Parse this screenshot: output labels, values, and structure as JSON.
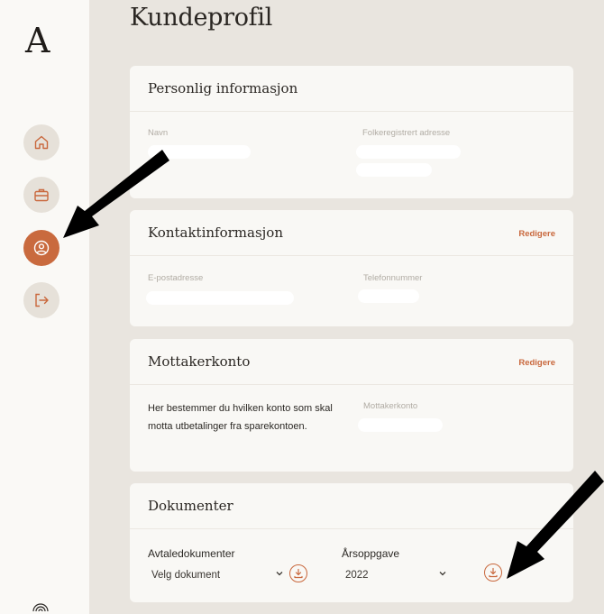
{
  "sidebar": {
    "logo": "A",
    "nav": [
      "home-icon",
      "briefcase-icon",
      "user-circle-icon",
      "logout-icon"
    ],
    "active_index": 2
  },
  "page": {
    "title": "Kundeprofil"
  },
  "personal": {
    "title": "Personlig informasjon",
    "name_label": "Navn",
    "address_label": "Folkeregistrert adresse"
  },
  "contact": {
    "title": "Kontaktinformasjon",
    "edit_label": "Redigere",
    "email_label": "E-postadresse",
    "phone_label": "Telefonnummer"
  },
  "account": {
    "title": "Mottakerkonto",
    "edit_label": "Redigere",
    "description": "Her bestemmer du hvilken konto som skal motta utbetalinger fra sparekontoen.",
    "account_label": "Mottakerkonto"
  },
  "documents": {
    "title": "Dokumenter",
    "agreement_label": "Avtaledokumenter",
    "agreement_selected": "Velg dokument",
    "tax_label": "Årsoppgave",
    "tax_selected": "2022"
  },
  "colors": {
    "accent": "#c9683d",
    "background": "#e9e5df",
    "card": "#f9f8f5"
  }
}
